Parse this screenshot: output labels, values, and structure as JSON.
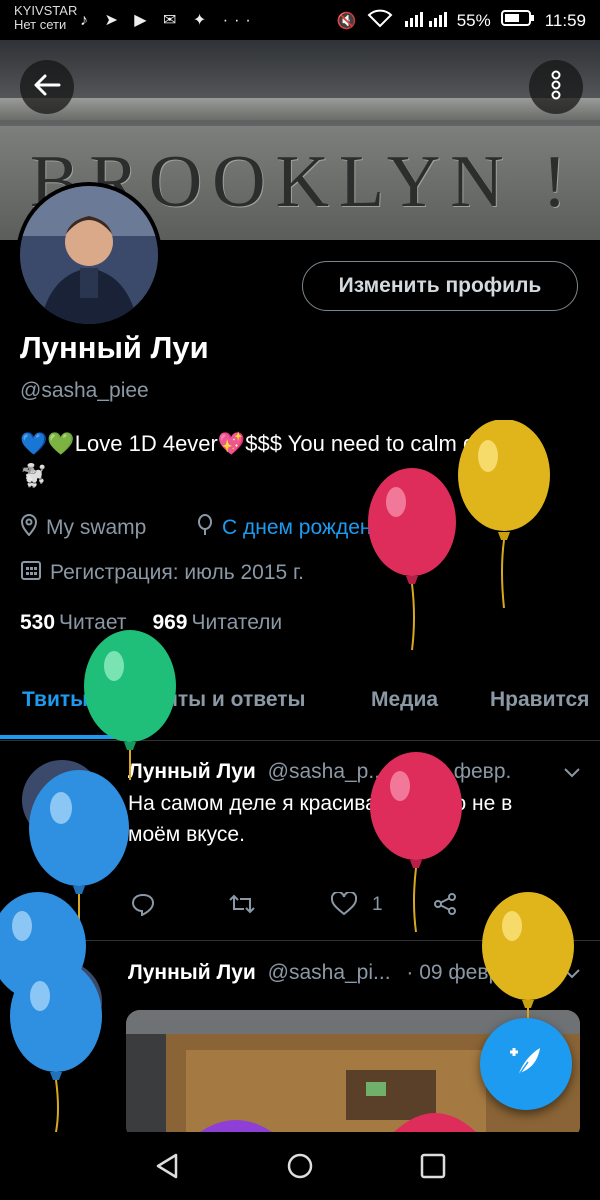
{
  "status_bar": {
    "carrier": "KYIVSTAR",
    "network_status": "Нет сети",
    "app_icons": "♪ ➤ ▶ ✉ ✦ ···",
    "battery_percent": "55%",
    "time": "11:59"
  },
  "header": {
    "banner_text": "BROOKLYN !"
  },
  "profile": {
    "name": "Лунный Луи",
    "handle": "@sasha_piee",
    "edit_button": "Изменить профиль",
    "bio_line1": "💙💚Love 1D 4ever💖$$$ You need to calm down",
    "bio_line2": "🐩",
    "location": "My swamp",
    "birthday": "С днем рождения!",
    "registration": "Регистрация: июль 2015 г.",
    "following_count": "530",
    "following_label": "Читает",
    "followers_count": "969",
    "followers_label": "Читатели"
  },
  "tabs": [
    {
      "label": "Твиты"
    },
    {
      "label": "Твиты и ответы"
    },
    {
      "label": "Медиа"
    },
    {
      "label": "Нравится"
    }
  ],
  "tweets": [
    {
      "author": "Лунный Луи",
      "handle": "@sasha_p...",
      "date": "· 16 февр.",
      "text": "На самом деле я красивая, просто не в моём вкусе.",
      "likes": "1"
    },
    {
      "author": "Лунный Луи",
      "handle": "@sasha_pi...",
      "date": "· 09 февр."
    }
  ],
  "colors": {
    "accent": "#1d9bf0",
    "background": "#000000",
    "secondary_text": "#8b98a5"
  }
}
